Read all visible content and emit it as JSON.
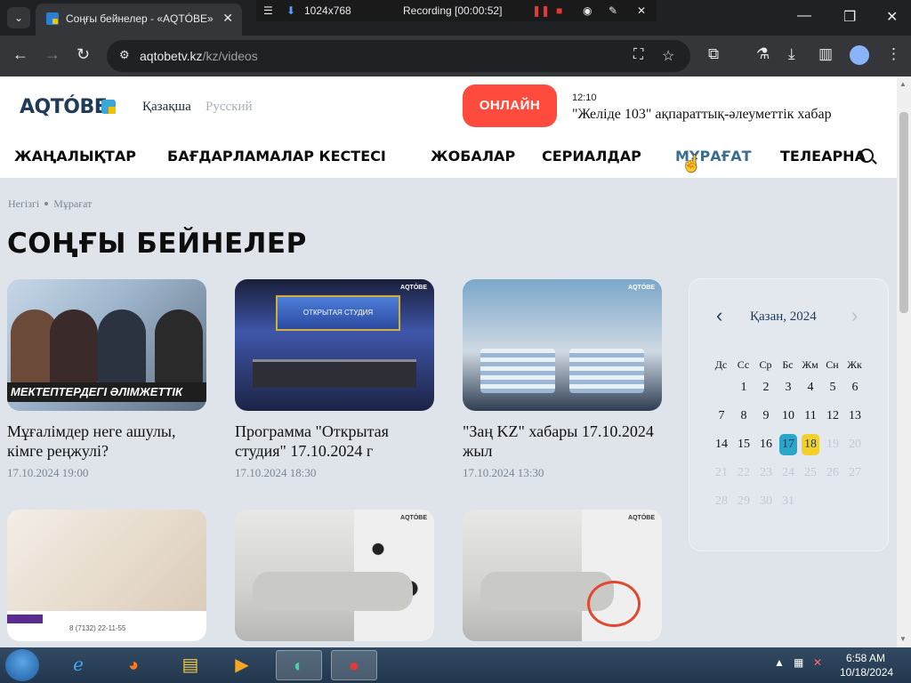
{
  "browser": {
    "tab_title": "Соңғы бейнелер - «AQTÓBE»",
    "tab_menu_icon": "chevron-down-icon",
    "url_domain": "aqtobetv.kz",
    "url_path": "/kz/videos"
  },
  "recorder": {
    "resolution": "1024x768",
    "status": "Recording [00:00:52]"
  },
  "site": {
    "logo": "AQTÓBE",
    "lang_kk": "Қазақша",
    "lang_ru": "Русский",
    "online_label": "ОНЛАЙН",
    "now_time": "12:10",
    "now_title": "\"Желіде 103\" ақпараттық-әлеуметтік хабар",
    "nav": [
      {
        "label": "ЖАҢАЛЫҚТАР"
      },
      {
        "label": "БАҒДАРЛАМАЛАР КЕСТЕСІ"
      },
      {
        "label": "ЖОБАЛАР"
      },
      {
        "label": "СЕРИАЛДАР"
      },
      {
        "label": "МҰРАҒАТ"
      },
      {
        "label": "ТЕЛЕАРНА"
      }
    ],
    "active_color": "#3a6d8f",
    "online_color": "#ff4b3e"
  },
  "breadcrumb": {
    "home": "Негізгі",
    "current": "Мұрағат"
  },
  "page_title": "СОҢҒЫ БЕЙНЕЛЕР",
  "videos": [
    {
      "title": "Мұғалімдер неге ашулы, кімге реңжулі?",
      "date": "17.10.2024 19:00",
      "ticker": "МЕКТЕПТЕРДЕГІ ӘЛІМЖЕТТІК"
    },
    {
      "title": "Программа \"Открытая студия\" 17.10.2024 г",
      "date": "17.10.2024 18:30",
      "screen": "ОТКРЫТАЯ СТУДИЯ"
    },
    {
      "title": "\"Заң KZ\" хабары 17.10.2024 жыл",
      "date": "17.10.2024 13:30"
    },
    {
      "title": "",
      "date": "",
      "phone": "8 (7132) 22-11-55"
    },
    {
      "title": "",
      "date": ""
    },
    {
      "title": "",
      "date": ""
    }
  ],
  "thumb_badge": "AQTÓBE",
  "calendar": {
    "month_label": "Қазан, 2024",
    "weekdays": [
      "Дс",
      "Сс",
      "Ср",
      "Бс",
      "Жм",
      "Сн",
      "Жк"
    ],
    "days": [
      "1",
      "2",
      "3",
      "4",
      "5",
      "6",
      "7",
      "8",
      "9",
      "10",
      "11",
      "12",
      "13",
      "14",
      "15",
      "16",
      "17",
      "18",
      "19",
      "20",
      "21",
      "22",
      "23",
      "24",
      "25",
      "26",
      "27",
      "28",
      "29",
      "30",
      "31"
    ],
    "today": "17",
    "selected": "18",
    "today_color": "#2aa6c9",
    "selected_color": "#f3d02a"
  },
  "taskbar": {
    "time": "6:58 AM",
    "date": "10/18/2024"
  }
}
